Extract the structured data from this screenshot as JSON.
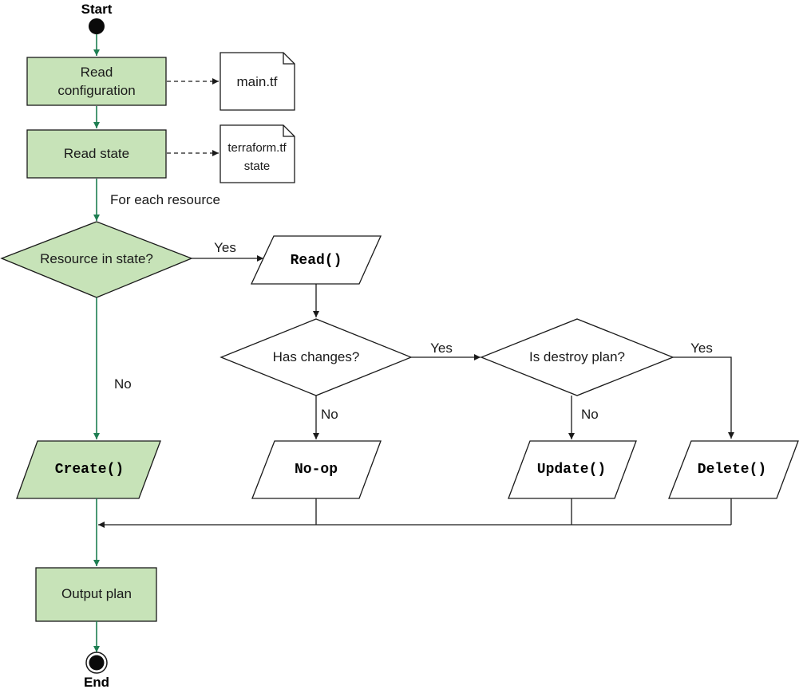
{
  "start": {
    "label": "Start"
  },
  "end": {
    "label": "End"
  },
  "nodes": {
    "read_config": {
      "line1": "Read",
      "line2": "configuration"
    },
    "read_state": {
      "label": "Read state"
    },
    "main_tf": {
      "label": "main.tf"
    },
    "tfstate": {
      "line1": "terraform.tf",
      "line2": "state"
    },
    "resource_in_state": {
      "label": "Resource in state?"
    },
    "read_fn": {
      "label": "Read()"
    },
    "has_changes": {
      "label": "Has changes?"
    },
    "is_destroy": {
      "label": "Is destroy plan?"
    },
    "create_fn": {
      "label": "Create()"
    },
    "noop": {
      "label": "No-op"
    },
    "update_fn": {
      "label": "Update()"
    },
    "delete_fn": {
      "label": "Delete()"
    },
    "output_plan": {
      "label": "Output plan"
    }
  },
  "edge_labels": {
    "for_each": "For each resource",
    "yes_resource": "Yes",
    "no_resource": "No",
    "yes_changes": "Yes",
    "no_changes": "No",
    "yes_destroy": "Yes",
    "no_destroy": "No"
  },
  "colors": {
    "green_fill": "#c7e3b8",
    "green_arrow": "#1e7e52",
    "black": "#1a1a1a"
  }
}
